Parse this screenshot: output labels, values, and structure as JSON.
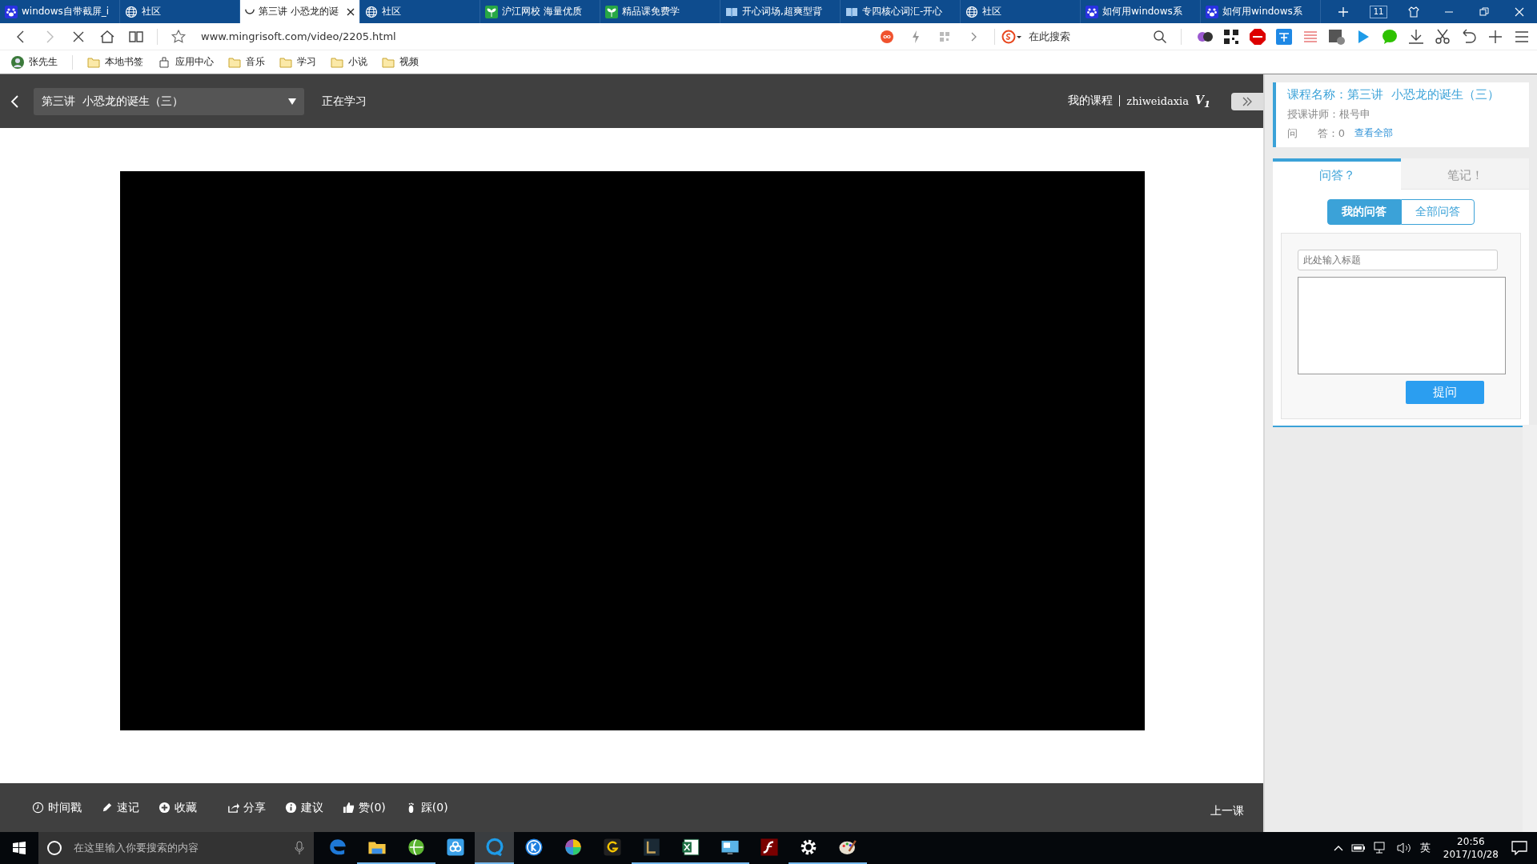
{
  "browser_tabs": [
    {
      "title": "windows自带截屏_i",
      "kind": "paw",
      "selected": false
    },
    {
      "title": "社区",
      "kind": "globe",
      "selected": false
    },
    {
      "title": "第三讲 小恐龙的诞",
      "kind": "loading",
      "selected": true
    },
    {
      "title": "社区",
      "kind": "globe",
      "selected": false
    },
    {
      "title": "沪江网校 海量优质",
      "kind": "sprout",
      "selected": false
    },
    {
      "title": "精品课免费学",
      "kind": "sprout",
      "selected": false
    },
    {
      "title": "开心词场,超爽型背",
      "kind": "book",
      "selected": false
    },
    {
      "title": "专四核心词汇-开心",
      "kind": "book",
      "selected": false
    },
    {
      "title": "社区",
      "kind": "globe",
      "selected": false
    },
    {
      "title": "如何用windows系",
      "kind": "paw",
      "selected": false
    },
    {
      "title": "如何用windows系",
      "kind": "paw",
      "selected": false
    }
  ],
  "tab_count": "11",
  "address": "www.mingrisoft.com/video/2205.html",
  "search": {
    "placeholder": "在此搜索"
  },
  "bookmarks": [
    {
      "label": "张先生",
      "kind": "user"
    },
    {
      "label": "本地书签",
      "kind": "folder"
    },
    {
      "label": "应用中心",
      "kind": "app"
    },
    {
      "label": "音乐",
      "kind": "folder"
    },
    {
      "label": "学习",
      "kind": "folder"
    },
    {
      "label": "小说",
      "kind": "folder"
    },
    {
      "label": "视频",
      "kind": "folder"
    }
  ],
  "course_header": {
    "lesson_select": "第三讲  小恐龙的诞生（三）",
    "status": "正在学习",
    "my_courses": "我的课程",
    "username": "zhiweidaxia",
    "vip_badge": "V$_{1}$"
  },
  "side_panel": {
    "course_name": "课程名称：第三讲  小恐龙的诞生（三）",
    "teacher": "授课讲师：根号申",
    "qa_count": "问      答：0",
    "view_all": "查看全部",
    "tabs": [
      {
        "label": "问答？",
        "selected": true
      },
      {
        "label": "笔记！",
        "selected": false
      }
    ],
    "sub_tabs": [
      {
        "label": "我的问答",
        "selected": true
      },
      {
        "label": "全部问答",
        "selected": false
      }
    ],
    "title_field": {
      "placeholder": "此处输入标题"
    },
    "submit": "提问"
  },
  "actions": [
    {
      "label": "时间戳",
      "kind": "clock"
    },
    {
      "label": "速记",
      "kind": "pencil"
    },
    {
      "label": "收藏",
      "kind": "plus"
    },
    {
      "label": "分享",
      "kind": "share"
    },
    {
      "label": "建议",
      "kind": "info"
    },
    {
      "label": "赞(0)",
      "kind": "thumb"
    },
    {
      "label": "踩(0)",
      "kind": "foot"
    }
  ],
  "previous_lesson": "上一课",
  "taskbar": {
    "search_placeholder": "在这里输入你要搜索的内容",
    "apps": [
      {
        "kind": "edge",
        "open": false,
        "selected": false
      },
      {
        "kind": "folder",
        "open": true,
        "selected": false
      },
      {
        "kind": "green-globe",
        "open": true,
        "selected": false
      },
      {
        "kind": "cloud",
        "open": false,
        "selected": false
      },
      {
        "kind": "browser",
        "open": true,
        "selected": true
      },
      {
        "kind": "k-circle",
        "open": false,
        "selected": false
      },
      {
        "kind": "color-wheel",
        "open": false,
        "selected": false
      },
      {
        "kind": "g-logo",
        "open": false,
        "selected": false
      },
      {
        "kind": "l-logo",
        "open": true,
        "selected": false
      },
      {
        "kind": "sheet",
        "open": true,
        "selected": false
      },
      {
        "kind": "monitor",
        "open": true,
        "selected": false
      },
      {
        "kind": "flash",
        "open": false,
        "selected": false
      },
      {
        "kind": "gear",
        "open": true,
        "selected": false
      },
      {
        "kind": "palette",
        "open": true,
        "selected": false
      }
    ],
    "language": "英",
    "time": "20:56",
    "date": "2017/10/28"
  }
}
